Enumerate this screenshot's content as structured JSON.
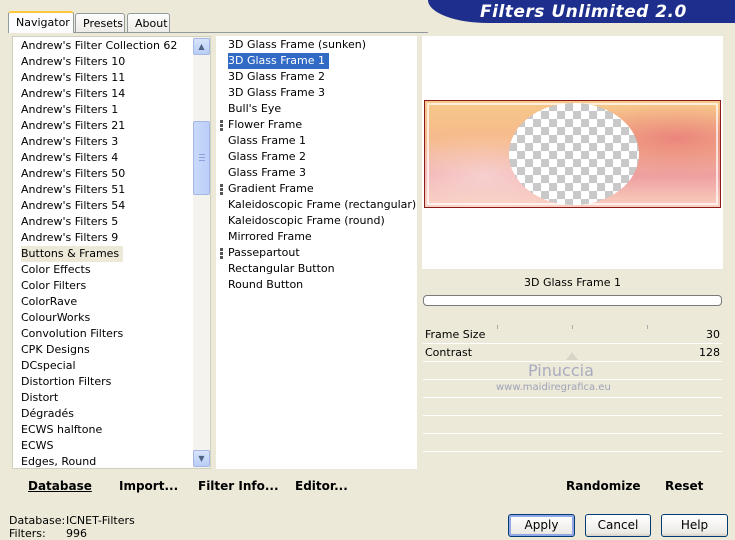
{
  "tabs": [
    "Navigator",
    "Presets",
    "About"
  ],
  "banner_title": "Filters Unlimited 2.0",
  "categories": [
    "Andrew's Filter Collection 62",
    "Andrew's Filters 10",
    "Andrew's Filters 11",
    "Andrew's Filters 14",
    "Andrew's Filters 1",
    "Andrew's Filters 21",
    "Andrew's Filters 3",
    "Andrew's Filters 4",
    "Andrew's Filters 50",
    "Andrew's Filters 51",
    "Andrew's Filters 54",
    "Andrew's Filters 5",
    "Andrew's Filters 9",
    "Buttons & Frames",
    "Color Effects",
    "Color Filters",
    "ColorRave",
    "ColourWorks",
    "Convolution Filters",
    "CPK Designs",
    "DCspecial",
    "Distortion Filters",
    "Distort",
    "Dégradés",
    "ECWS halftone",
    "ECWS",
    "Edges, Round"
  ],
  "filters": [
    "3D Glass Frame (sunken)",
    "3D Glass Frame 1",
    "3D Glass Frame 2",
    "3D Glass Frame 3",
    "Bull's Eye",
    "Flower Frame",
    "Glass Frame 1",
    "Glass Frame 2",
    "Glass Frame 3",
    "Gradient Frame",
    "Kaleidoscopic Frame (rectangular)",
    "Kaleidoscopic Frame (round)",
    "Mirrored Frame",
    "Passepartout",
    "Rectangular Button",
    "Round Button"
  ],
  "selected_filter_name": "3D Glass Frame 1",
  "params": [
    {
      "label": "Frame Size",
      "value": "30"
    },
    {
      "label": "Contrast",
      "value": "128"
    }
  ],
  "watermark": {
    "line1": "Pinuccia",
    "line2": "www.maidiregrafica.eu"
  },
  "list_buttons": {
    "database": "Database",
    "import": "Import...",
    "filter_info": "Filter Info...",
    "editor": "Editor..."
  },
  "preview_buttons": {
    "randomize": "Randomize",
    "reset": "Reset"
  },
  "status": {
    "database_label": "Database:",
    "database_value": "ICNET-Filters",
    "filters_label": "Filters:",
    "filters_value": "996"
  },
  "dialog_buttons": {
    "apply": "Apply",
    "cancel": "Cancel",
    "help": "Help"
  }
}
